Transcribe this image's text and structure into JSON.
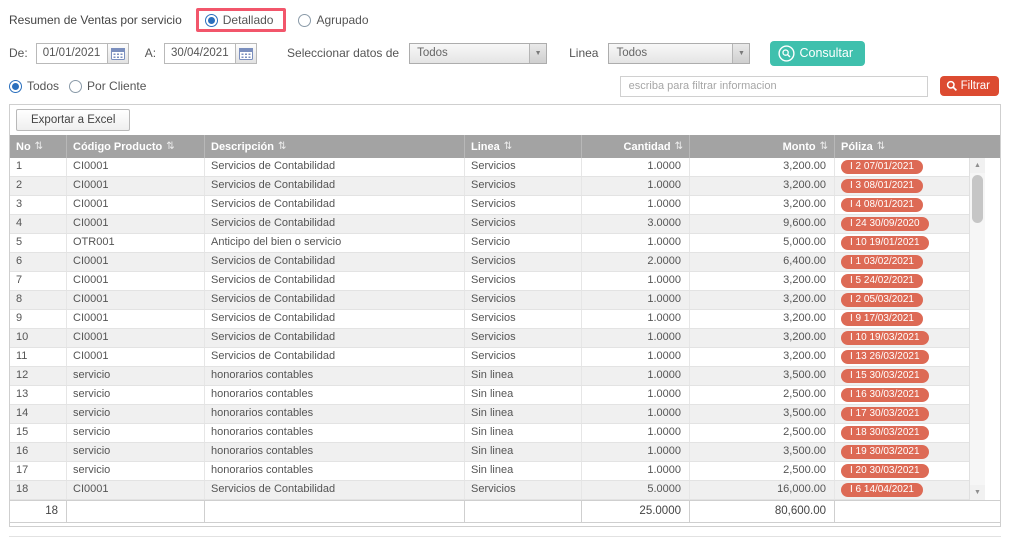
{
  "colors": {
    "accent-teal": "#3fc0ad",
    "accent-red": "#dc4b31",
    "badge-red": "#dd6a55",
    "header-gray": "#a3a3a3",
    "radio-blue": "#2a6fbd",
    "highlight-pink": "#f2566b"
  },
  "header": {
    "title": "Resumen de Ventas por servicio",
    "detallado_label": "Detallado",
    "agrupado_label": "Agrupado"
  },
  "filters": {
    "from_label": "De:",
    "from_value": "01/01/2021",
    "to_label": "A:",
    "to_value": "30/04/2021",
    "data_source_label": "Seleccionar datos de",
    "data_source_value": "Todos",
    "linea_label": "Linea",
    "linea_value": "Todos",
    "consultar_label": "Consultar"
  },
  "scope": {
    "todos_label": "Todos",
    "por_cliente_label": "Por Cliente",
    "filter_placeholder": "escriba para filtrar informacion",
    "filtrar_label": "Filtrar"
  },
  "toolbar": {
    "export_label": "Exportar a Excel"
  },
  "table": {
    "columns": [
      "No",
      "Código Producto",
      "Descripción",
      "Linea",
      "Cantidad",
      "Monto",
      "Póliza"
    ],
    "rows": [
      {
        "no": "1",
        "codigo": "CI0001",
        "descripcion": "Servicios de Contabilidad",
        "linea": "Servicios",
        "cantidad": "1.0000",
        "monto": "3,200.00",
        "poliza": "I 2 07/01/2021"
      },
      {
        "no": "2",
        "codigo": "CI0001",
        "descripcion": "Servicios de Contabilidad",
        "linea": "Servicios",
        "cantidad": "1.0000",
        "monto": "3,200.00",
        "poliza": "I 3 08/01/2021"
      },
      {
        "no": "3",
        "codigo": "CI0001",
        "descripcion": "Servicios de Contabilidad",
        "linea": "Servicios",
        "cantidad": "1.0000",
        "monto": "3,200.00",
        "poliza": "I 4 08/01/2021"
      },
      {
        "no": "4",
        "codigo": "CI0001",
        "descripcion": "Servicios de Contabilidad",
        "linea": "Servicios",
        "cantidad": "3.0000",
        "monto": "9,600.00",
        "poliza": "I 24 30/09/2020"
      },
      {
        "no": "5",
        "codigo": "OTR001",
        "descripcion": "Anticipo del bien o servicio",
        "linea": "Servicio",
        "cantidad": "1.0000",
        "monto": "5,000.00",
        "poliza": "I 10 19/01/2021"
      },
      {
        "no": "6",
        "codigo": "CI0001",
        "descripcion": "Servicios de Contabilidad",
        "linea": "Servicios",
        "cantidad": "2.0000",
        "monto": "6,400.00",
        "poliza": "I 1 03/02/2021"
      },
      {
        "no": "7",
        "codigo": "CI0001",
        "descripcion": "Servicios de Contabilidad",
        "linea": "Servicios",
        "cantidad": "1.0000",
        "monto": "3,200.00",
        "poliza": "I 5 24/02/2021"
      },
      {
        "no": "8",
        "codigo": "CI0001",
        "descripcion": "Servicios de Contabilidad",
        "linea": "Servicios",
        "cantidad": "1.0000",
        "monto": "3,200.00",
        "poliza": "I 2 05/03/2021"
      },
      {
        "no": "9",
        "codigo": "CI0001",
        "descripcion": "Servicios de Contabilidad",
        "linea": "Servicios",
        "cantidad": "1.0000",
        "monto": "3,200.00",
        "poliza": "I 9 17/03/2021"
      },
      {
        "no": "10",
        "codigo": "CI0001",
        "descripcion": "Servicios de Contabilidad",
        "linea": "Servicios",
        "cantidad": "1.0000",
        "monto": "3,200.00",
        "poliza": "I 10 19/03/2021"
      },
      {
        "no": "11",
        "codigo": "CI0001",
        "descripcion": "Servicios de Contabilidad",
        "linea": "Servicios",
        "cantidad": "1.0000",
        "monto": "3,200.00",
        "poliza": "I 13 26/03/2021"
      },
      {
        "no": "12",
        "codigo": "servicio",
        "descripcion": "honorarios contables",
        "linea": "Sin linea",
        "cantidad": "1.0000",
        "monto": "3,500.00",
        "poliza": "I 15 30/03/2021"
      },
      {
        "no": "13",
        "codigo": "servicio",
        "descripcion": "honorarios contables",
        "linea": "Sin linea",
        "cantidad": "1.0000",
        "monto": "2,500.00",
        "poliza": "I 16 30/03/2021"
      },
      {
        "no": "14",
        "codigo": "servicio",
        "descripcion": "honorarios contables",
        "linea": "Sin linea",
        "cantidad": "1.0000",
        "monto": "3,500.00",
        "poliza": "I 17 30/03/2021"
      },
      {
        "no": "15",
        "codigo": "servicio",
        "descripcion": "honorarios contables",
        "linea": "Sin linea",
        "cantidad": "1.0000",
        "monto": "2,500.00",
        "poliza": "I 18 30/03/2021"
      },
      {
        "no": "16",
        "codigo": "servicio",
        "descripcion": "honorarios contables",
        "linea": "Sin linea",
        "cantidad": "1.0000",
        "monto": "3,500.00",
        "poliza": "I 19 30/03/2021"
      },
      {
        "no": "17",
        "codigo": "servicio",
        "descripcion": "honorarios contables",
        "linea": "Sin linea",
        "cantidad": "1.0000",
        "monto": "2,500.00",
        "poliza": "I 20 30/03/2021"
      },
      {
        "no": "18",
        "codigo": "CI0001",
        "descripcion": "Servicios de Contabilidad",
        "linea": "Servicios",
        "cantidad": "5.0000",
        "monto": "16,000.00",
        "poliza": "I 6 14/04/2021"
      }
    ],
    "footer": {
      "count": "18",
      "cantidad_total": "25.0000",
      "monto_total": "80,600.00"
    }
  }
}
